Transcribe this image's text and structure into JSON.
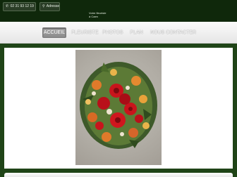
{
  "topbar": {
    "phone": {
      "icon": "phone-icon",
      "label": "02 31 93 12 19"
    },
    "address": {
      "icon": "map-marker-icon",
      "label": "Adresse"
    },
    "tagline": [
      "Votre fleuriste",
      "à Caen"
    ]
  },
  "nav": {
    "items": [
      {
        "label": "ACCUEIL",
        "active": true
      },
      {
        "label": "FLEURISTE",
        "active": false
      },
      {
        "label": "PHOTOS",
        "active": false
      },
      {
        "label": "PLAN",
        "active": false
      },
      {
        "label": "NOUS CONTACTER",
        "active": false
      }
    ]
  },
  "colors": {
    "page_background": "#1f4417",
    "topbar": "#0f280b",
    "nav_active": "#959595"
  },
  "main": {
    "image": "floral-arrangement-photo"
  }
}
